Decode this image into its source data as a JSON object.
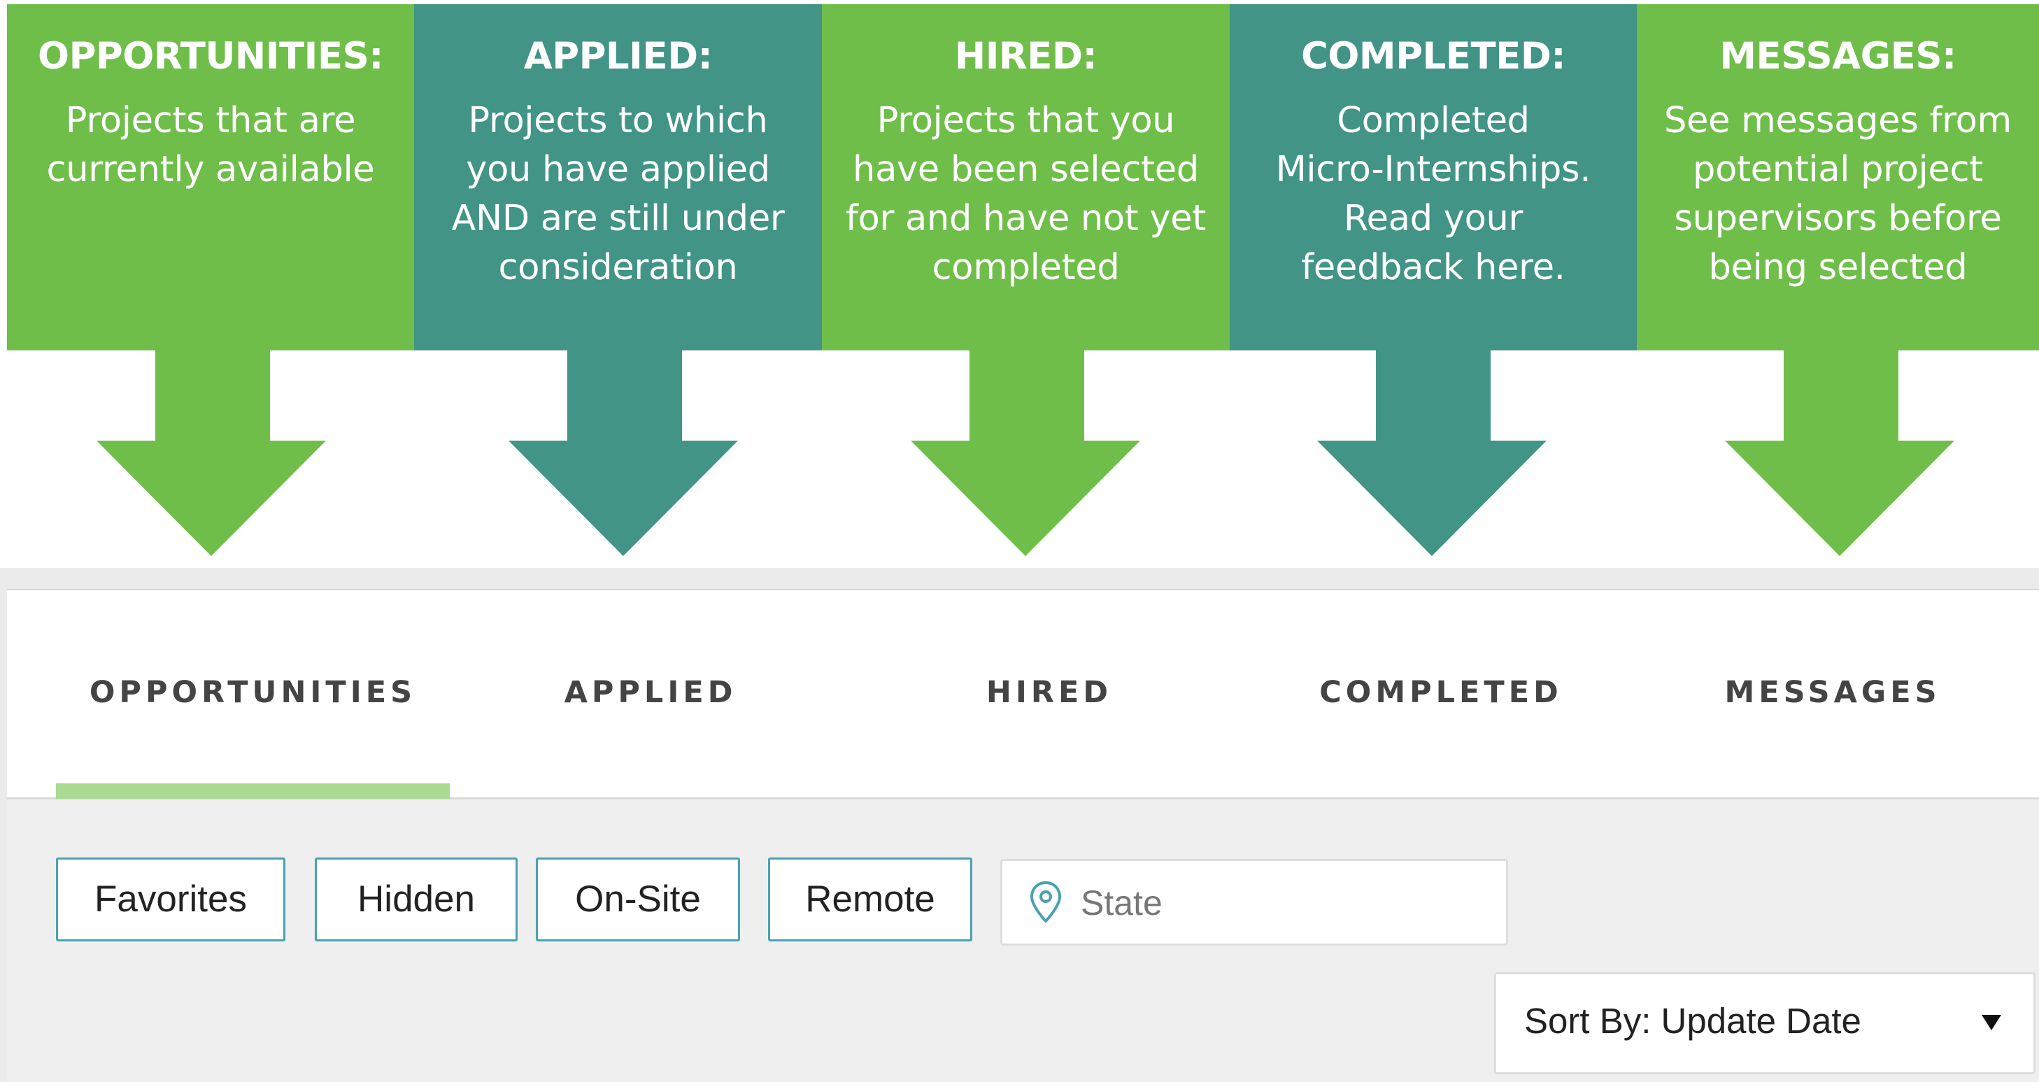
{
  "annotations": [
    {
      "title": "OPPORTUNITIES:",
      "description": "Projects that are\ncurrently available",
      "color": "#6fbe4a"
    },
    {
      "title": "APPLIED:",
      "description": "Projects to which\nyou have applied\nAND are still under\nconsideration",
      "color": "#419486"
    },
    {
      "title": "HIRED:",
      "description": "Projects that you\nhave been selected\nfor and have not yet\ncompleted",
      "color": "#6fbe4a"
    },
    {
      "title": "COMPLETED:",
      "description": "Completed\nMicro-Internships.\nRead your\nfeedback here.",
      "color": "#419486"
    },
    {
      "title": "MESSAGES:",
      "description": "See messages from\npotential project\nsupervisors before\nbeing selected",
      "color": "#6fbe4a"
    }
  ],
  "tabs": [
    {
      "label": "OPPORTUNITIES",
      "active": true
    },
    {
      "label": "APPLIED",
      "active": false
    },
    {
      "label": "HIRED",
      "active": false
    },
    {
      "label": "COMPLETED",
      "active": false
    },
    {
      "label": "MESSAGES",
      "active": false
    }
  ],
  "filters": [
    {
      "label": "Favorites"
    },
    {
      "label": "Hidden"
    },
    {
      "label": "On-Site"
    },
    {
      "label": "Remote"
    }
  ],
  "state_search": {
    "placeholder": "State",
    "value": "",
    "icon": "location-pin-icon"
  },
  "sort": {
    "label": "Sort By: Update Date",
    "icon": "caret-down-icon"
  },
  "colors": {
    "green": "#6fbe4a",
    "teal": "#419486",
    "active_tab_underline": "#a9dc92",
    "filter_border": "#4aa2b1"
  }
}
